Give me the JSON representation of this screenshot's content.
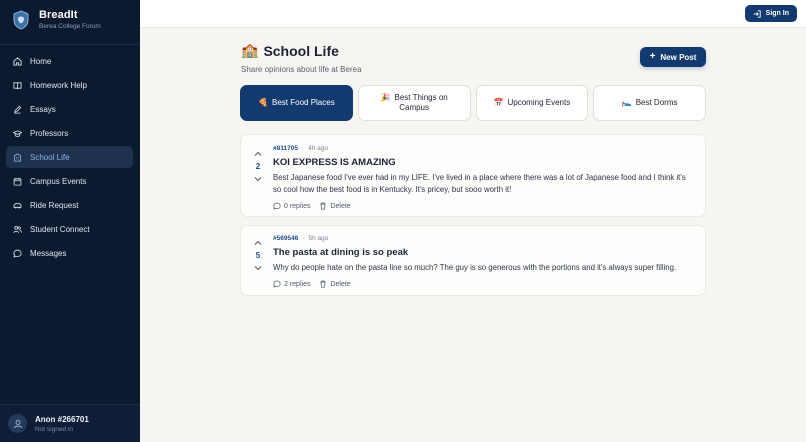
{
  "brand": {
    "name": "BreadIt",
    "subtitle": "Berea College Forum",
    "logo_icon": "shield-logo-icon"
  },
  "sidebar": {
    "items": [
      {
        "label": "Home",
        "icon": "home-icon"
      },
      {
        "label": "Homework Help",
        "icon": "book-icon"
      },
      {
        "label": "Essays",
        "icon": "pen-icon"
      },
      {
        "label": "Professors",
        "icon": "graduation-cap-icon"
      },
      {
        "label": "School Life",
        "icon": "building-icon",
        "active": true
      },
      {
        "label": "Campus Events",
        "icon": "calendar-icon"
      },
      {
        "label": "Ride Request",
        "icon": "car-icon"
      },
      {
        "label": "Student Connect",
        "icon": "users-icon"
      },
      {
        "label": "Messages",
        "icon": "message-icon"
      }
    ],
    "user": {
      "name": "Anon #266701",
      "status": "Not signed in"
    }
  },
  "topbar": {
    "signin_label": "Sign In"
  },
  "page": {
    "title_emoji": "🏫",
    "title": "School Life",
    "subtitle": "Share opinions about life at Berea",
    "new_post_label": "New Post"
  },
  "tabs": [
    {
      "emoji": "🍕",
      "label": "Best Food Places",
      "active": true
    },
    {
      "emoji": "🎉",
      "label": "Best Things on Campus"
    },
    {
      "emoji": "📅",
      "label": "Upcoming Events"
    },
    {
      "emoji": "🛌",
      "label": "Best Dorms"
    }
  ],
  "posts": [
    {
      "id": "#811705",
      "time": "4h ago",
      "votes": "2",
      "title": "KOI EXPRESS IS AMAZING",
      "text": "Best Japanese food I've ever had in my LIFE. I've lived in a place where there was a lot of Japanese food and I think it's so cool how the best food is in Kentucky. It's pricey, but sooo worth it!",
      "replies_label": "0 replies",
      "delete_label": "Delete"
    },
    {
      "id": "#569546",
      "time": "5h ago",
      "votes": "5",
      "title": "The pasta at dining is so peak",
      "text": "Why do people hate on the pasta line so much? The guy is so generous with the portions and it's always super filling.",
      "replies_label": "2 replies",
      "delete_label": "Delete"
    }
  ],
  "meta_separator": "·",
  "colors": {
    "sidebar_bg": "#0c1a30",
    "accent": "#123a6e",
    "vote_color": "#1f4a86",
    "page_bg": "#f6f5f2"
  }
}
